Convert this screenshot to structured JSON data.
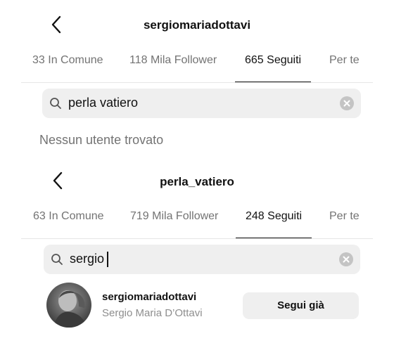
{
  "panel1": {
    "title": "sergiomariadottavi",
    "tabs": [
      "33 In Comune",
      "118 Mila Follower",
      "665 Seguiti",
      "Per te"
    ],
    "active_tab": 2,
    "search_value": "perla vatiero",
    "empty_message": "Nessun utente trovato"
  },
  "panel2": {
    "title": "perla_vatiero",
    "tabs": [
      "63 In Comune",
      "719 Mila Follower",
      "248 Seguiti",
      "Per te"
    ],
    "active_tab": 2,
    "search_value": "sergio",
    "result": {
      "username": "sergiomariadottavi",
      "full_name": "Sergio Maria D’Ottavi",
      "button_label": "Segui già"
    }
  },
  "icons": [
    "back-arrow-icon",
    "search-icon",
    "clear-icon"
  ]
}
